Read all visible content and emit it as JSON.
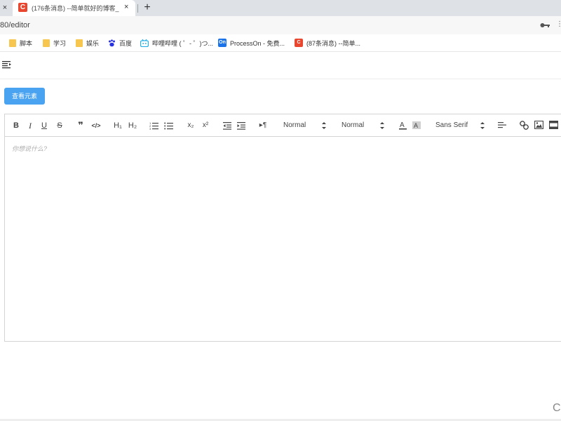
{
  "browser": {
    "tab_close_left": "×",
    "active_tab": {
      "favicon": "C",
      "title": "(176条消息) --简单就好的博客_",
      "close": "×"
    },
    "new_tab": "+",
    "url": "80/editor",
    "address_right": "⋮",
    "bookmarks": [
      {
        "label": "脚本",
        "icon": "folder-icon"
      },
      {
        "label": "学习",
        "icon": "folder-icon"
      },
      {
        "label": "娱乐",
        "icon": "folder-icon"
      },
      {
        "label": "百度",
        "icon": "baidu-icon"
      },
      {
        "label": "哔哩哔哩 ( ゜- ゜)つ...",
        "icon": "bilibili-icon"
      },
      {
        "label": "ProcessOn - 免费...",
        "icon": "processon-icon",
        "badge": "On"
      },
      {
        "label": "(87条消息) --简单...",
        "icon": "csdn-icon",
        "badge": "C"
      }
    ]
  },
  "page": {
    "primary_button": "查看元素",
    "editor": {
      "placeholder": "你想说什么?",
      "toolbar": {
        "bold": "B",
        "italic": "I",
        "underline": "U",
        "strike": "S",
        "blockquote": "❞",
        "code": "</>",
        "h1": "H₁",
        "h2": "H₂",
        "subscript": "x₂",
        "superscript": "x²",
        "direction": "▸¶",
        "size_picker": "Normal",
        "header_picker": "Normal",
        "font_picker": "Sans Serif"
      }
    },
    "corner_glyph": "C"
  },
  "colors": {
    "accent": "#4aa3f0",
    "favicon_red": "#e8462e",
    "folder": "#f6c64e",
    "bilibili": "#23ade5",
    "processon": "#1a73e8"
  }
}
